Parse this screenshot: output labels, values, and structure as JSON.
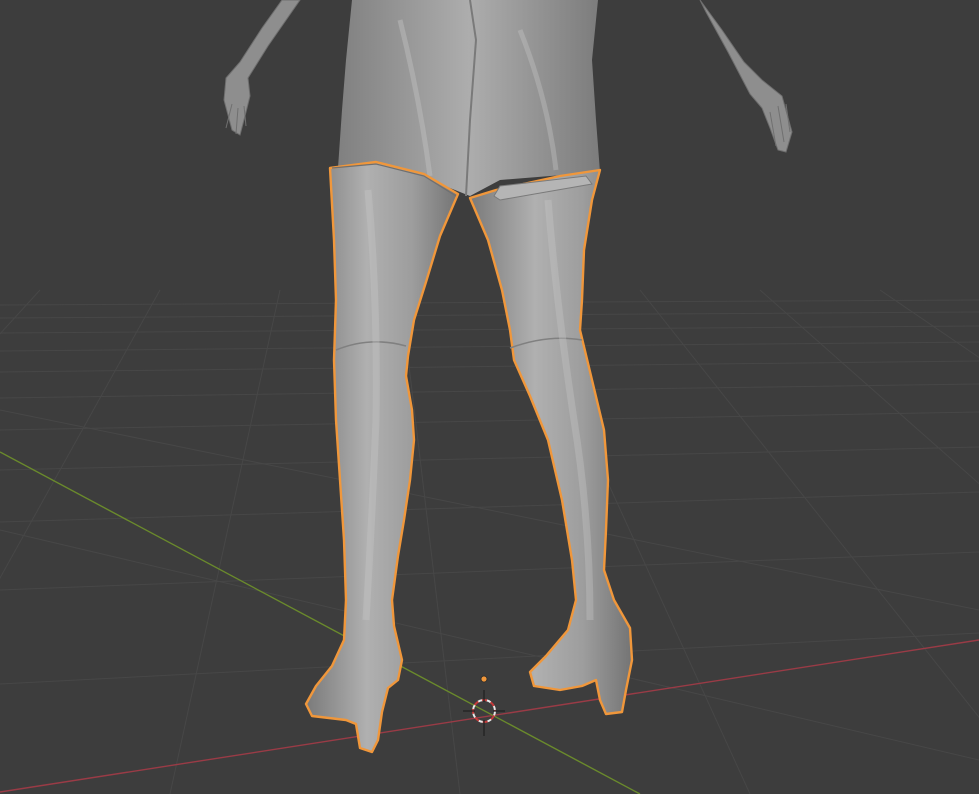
{
  "viewport": {
    "background_color": "#3d3d3d",
    "grid_line_color": "#474747",
    "x_axis_color": "#9a3b46",
    "y_axis_color": "#6a8a2c",
    "selection_outline_color": "#f0973b",
    "model_color": "#9b9b9b"
  },
  "scene": {
    "selected_object": "boots",
    "gizmo": "3d-cursor-icon",
    "origin_marker": "object-origin-dot"
  }
}
